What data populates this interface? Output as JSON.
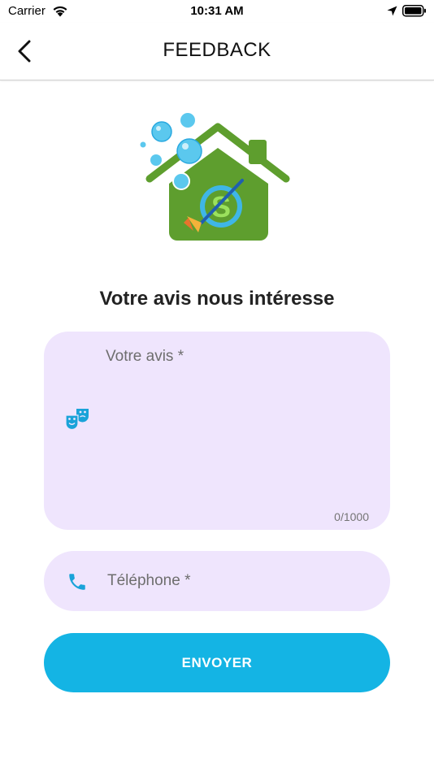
{
  "status_bar": {
    "carrier": "Carrier",
    "time": "10:31 AM",
    "icons": [
      "wifi-icon",
      "location-arrow-icon",
      "battery-icon"
    ]
  },
  "nav": {
    "title": "FEEDBACK",
    "back_icon": "chevron-left-icon"
  },
  "logo": {
    "icon": "cleaning-house-logo",
    "colors": {
      "house": "#5e9e2e",
      "bubbles": "#5bc8ee",
      "accent": "#3fb6e6"
    }
  },
  "heading": "Votre avis nous intéresse",
  "feedback": {
    "placeholder": "Votre avis *",
    "value": "",
    "counter": "0/1000",
    "icon": "theater-masks-icon"
  },
  "phone": {
    "placeholder": "Téléphone *",
    "value": "",
    "icon": "phone-icon"
  },
  "submit": {
    "label": "ENVOYER"
  },
  "colors": {
    "field_background": "#efe5fd",
    "primary": "#14b4e4",
    "icon_accent": "#1aa3d9"
  }
}
